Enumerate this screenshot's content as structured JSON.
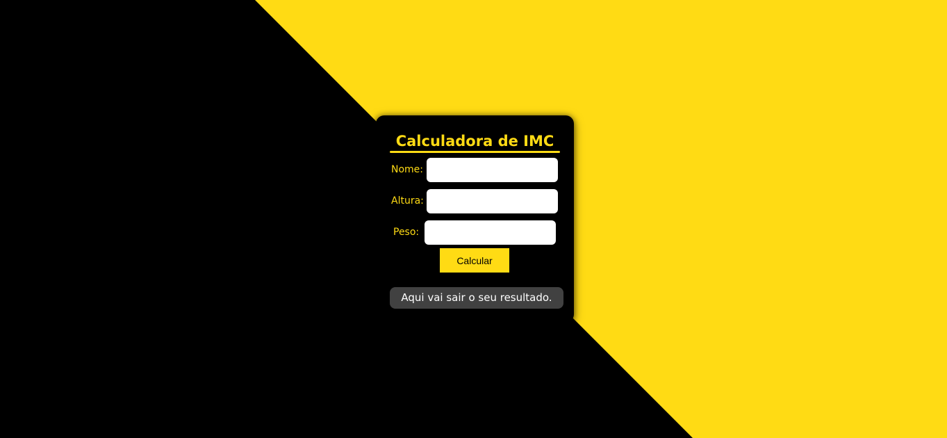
{
  "colors": {
    "accent": "#FFDB14",
    "background_dark": "#000000",
    "card": "#000000",
    "result_box": "#414141",
    "input_bg": "#FFFFFF"
  },
  "card": {
    "title": "Calculadora de IMC"
  },
  "form": {
    "fields": [
      {
        "label": "Nome:",
        "value": "",
        "placeholder": ""
      },
      {
        "label": "Altura:",
        "value": "",
        "placeholder": ""
      },
      {
        "label": "Peso:",
        "value": "",
        "placeholder": ""
      }
    ],
    "button_label": "Calcular"
  },
  "result": {
    "text": "Aqui vai sair o seu resultado."
  }
}
